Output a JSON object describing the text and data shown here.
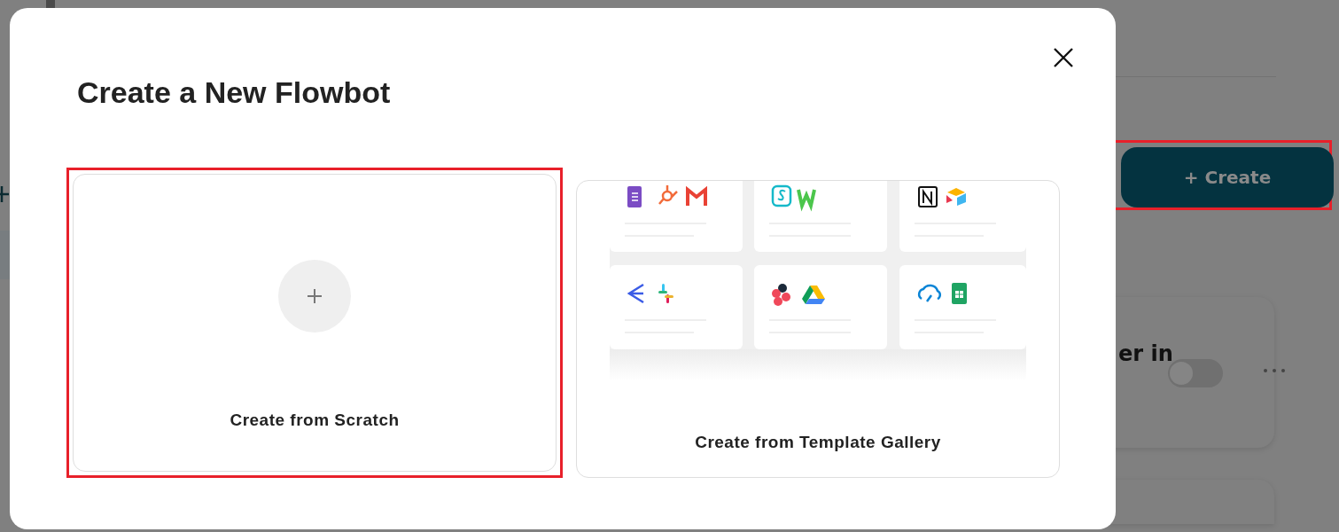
{
  "background": {
    "create_button": {
      "label": "+ Create",
      "highlighted": true
    },
    "flowbot_card": {
      "title": "er in",
      "on": false
    }
  },
  "dialog": {
    "title": "Create a New Flowbot",
    "options": [
      {
        "kind": "scratch",
        "label": "Create from Scratch",
        "highlighted": true
      },
      {
        "kind": "template",
        "label": "Create from Template Gallery",
        "highlighted": false
      }
    ]
  }
}
